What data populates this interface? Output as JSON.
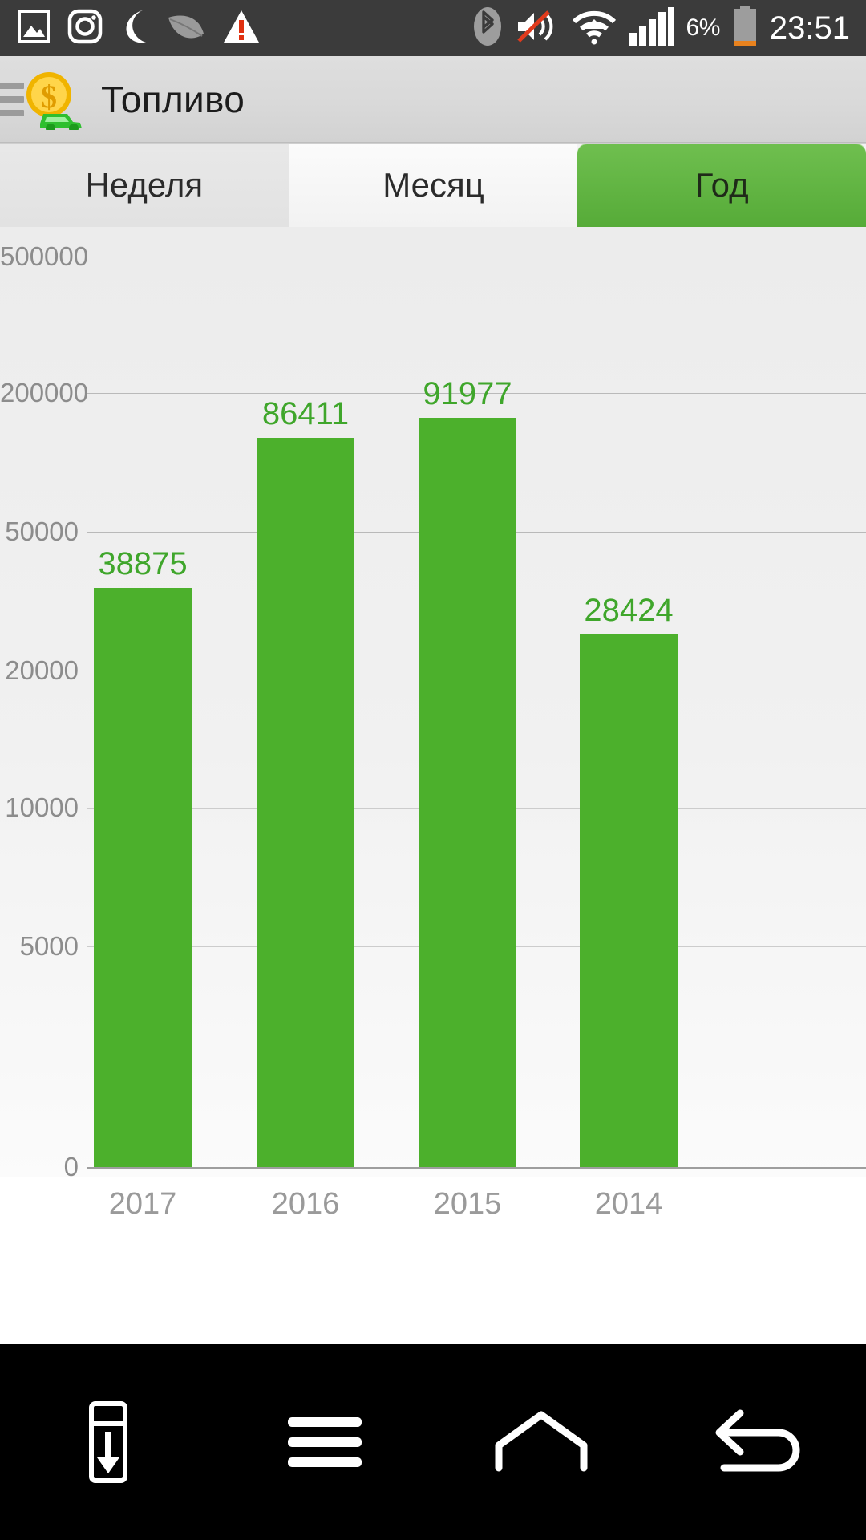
{
  "statusbar": {
    "time": "23:51",
    "battery_percent": "6%",
    "left_icons": [
      {
        "name": "screenshot-icon"
      },
      {
        "name": "camera-icon"
      },
      {
        "name": "moon-icon"
      },
      {
        "name": "leaf-icon"
      },
      {
        "name": "warning-icon"
      }
    ],
    "right_icons": [
      {
        "name": "bluetooth-icon"
      },
      {
        "name": "volume-mute-icon"
      },
      {
        "name": "wifi-icon"
      },
      {
        "name": "signal-bars-icon"
      },
      {
        "name": "battery-icon"
      }
    ]
  },
  "appbar": {
    "title": "Топливо",
    "menu_icon": "hamburger-icon",
    "app_icon": "coin-car-icon"
  },
  "tabs": [
    {
      "label": "Неделя",
      "selected": false
    },
    {
      "label": "Месяц",
      "selected": false
    },
    {
      "label": "Год",
      "selected": true
    }
  ],
  "colors": {
    "bar": "#4cb02c",
    "bar_label": "#3fa62b",
    "tab_selected": "#56ab38",
    "grid": "#b9b9b9",
    "axis_text": "#8c8c8c"
  },
  "chart_data": {
    "type": "bar",
    "title": "",
    "xlabel": "",
    "ylabel": "",
    "categories": [
      "2017",
      "2016",
      "2015",
      "2014"
    ],
    "values": [
      38875,
      86411,
      91977,
      28424
    ],
    "value_labels": [
      "38875",
      "86411",
      "91977",
      "28424"
    ],
    "ytick_labels": [
      "500000",
      "200000",
      "50000",
      "20000",
      "10000",
      "5000",
      "0"
    ],
    "ytick_values": [
      500000,
      200000,
      50000,
      20000,
      10000,
      5000,
      0
    ],
    "ylim": [
      0,
      500000
    ],
    "grid": true,
    "legend": "none",
    "note": "Y axis uses non-linear custom tick spacing; left edge of tick labels is clipped by the screen."
  },
  "navbar": {
    "buttons": [
      {
        "name": "pull-down-notification-button",
        "icon": "download-box-icon"
      },
      {
        "name": "menu-button",
        "icon": "menu-icon"
      },
      {
        "name": "home-button",
        "icon": "home-icon"
      },
      {
        "name": "back-button",
        "icon": "back-arrow-icon"
      }
    ]
  }
}
